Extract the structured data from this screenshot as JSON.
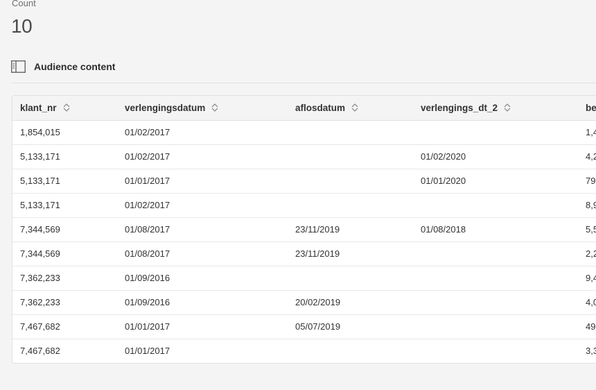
{
  "metric": {
    "label": "Count",
    "value": "10"
  },
  "section": {
    "title": "Audience content",
    "icon": "table-panel-icon"
  },
  "table": {
    "columns": [
      "klant_nr",
      "verlengingsdatum",
      "aflosdatum",
      "verlengings_dt_2",
      "be"
    ],
    "sort_icon": "sort-chevrons-icon",
    "rows": [
      [
        "1,854,015",
        "01/02/2017",
        "",
        "",
        "1,4"
      ],
      [
        "5,133,171",
        "01/02/2017",
        "",
        "01/02/2020",
        "4,2"
      ],
      [
        "5,133,171",
        "01/01/2017",
        "",
        "01/01/2020",
        "79"
      ],
      [
        "5,133,171",
        "01/02/2017",
        "",
        "",
        "8,9"
      ],
      [
        "7,344,569",
        "01/08/2017",
        "23/11/2019",
        "01/08/2018",
        "5,5"
      ],
      [
        "7,344,569",
        "01/08/2017",
        "23/11/2019",
        "",
        "2,2"
      ],
      [
        "7,362,233",
        "01/09/2016",
        "",
        "",
        "9,4"
      ],
      [
        "7,362,233",
        "01/09/2016",
        "20/02/2019",
        "",
        "4,0"
      ],
      [
        "7,467,682",
        "01/01/2017",
        "05/07/2019",
        "",
        "49"
      ],
      [
        "7,467,682",
        "01/01/2017",
        "",
        "",
        "3,3"
      ]
    ]
  },
  "colors": {
    "background": "#f4f4f4",
    "table_bg": "#ffffff",
    "border": "#e1e1e1",
    "text": "#323232",
    "muted": "#6e6e6e"
  }
}
